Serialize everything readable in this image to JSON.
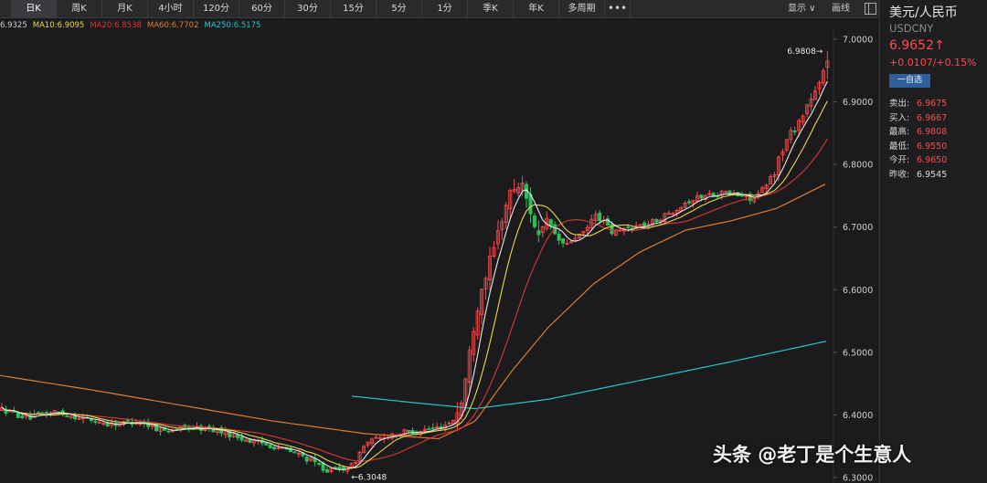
{
  "toolbar": {
    "timeframes": [
      {
        "label": "日K",
        "active": true
      },
      {
        "label": "周K",
        "active": false
      },
      {
        "label": "月K",
        "active": false
      },
      {
        "label": "4小时",
        "active": false
      },
      {
        "label": "120分",
        "active": false
      },
      {
        "label": "60分",
        "active": false
      },
      {
        "label": "30分",
        "active": false
      },
      {
        "label": "15分",
        "active": false
      },
      {
        "label": "5分",
        "active": false
      },
      {
        "label": "1分",
        "active": false
      },
      {
        "label": "季K",
        "active": false
      },
      {
        "label": "年K",
        "active": false
      },
      {
        "label": "多周期",
        "active": false
      }
    ],
    "more_label": "•••",
    "display_label": "显示 ∨",
    "draw_label": "画线"
  },
  "ma_bar": {
    "items": [
      {
        "label": "6.9325",
        "color": "#cfcfcf"
      },
      {
        "label": "MA10:6.9095",
        "color": "#e8d84a"
      },
      {
        "label": "MA20:6.8538",
        "color": "#d83838"
      },
      {
        "label": "MA60:6.7702",
        "color": "#e07a2a"
      },
      {
        "label": "MA250:6.5175",
        "color": "#26c6c6"
      }
    ]
  },
  "chart_data": {
    "type": "candlestick",
    "y_ticks": [
      "7.0000",
      "6.9000",
      "6.8000",
      "6.7000",
      "6.6000",
      "6.5000",
      "6.4000",
      "6.3000"
    ],
    "ylim": [
      6.3,
      7.0
    ],
    "high_marker": "6.9808",
    "low_marker": "6.3048",
    "up_color": "#ff4a4a",
    "down_color": "#2fbf5a",
    "ma_colors": {
      "ma5": "#e8e8e8",
      "ma10": "#e8d84a",
      "ma20": "#d83838",
      "ma60": "#e07a2a",
      "ma250": "#26c6c6"
    },
    "segments": [
      [
        0,
        6.41
      ],
      [
        30,
        6.395
      ],
      [
        60,
        6.405
      ],
      [
        90,
        6.395
      ],
      [
        120,
        6.385
      ],
      [
        150,
        6.39
      ],
      [
        180,
        6.375
      ],
      [
        210,
        6.38
      ],
      [
        240,
        6.375
      ],
      [
        270,
        6.36
      ],
      [
        300,
        6.35
      ],
      [
        330,
        6.335
      ],
      [
        360,
        6.31
      ],
      [
        385,
        6.318
      ],
      [
        400,
        6.355
      ],
      [
        430,
        6.37
      ],
      [
        460,
        6.375
      ],
      [
        480,
        6.38
      ],
      [
        495,
        6.39
      ],
      [
        505,
        6.42
      ],
      [
        512,
        6.48
      ],
      [
        520,
        6.56
      ],
      [
        530,
        6.62
      ],
      [
        540,
        6.66
      ],
      [
        550,
        6.72
      ],
      [
        560,
        6.76
      ],
      [
        570,
        6.77
      ],
      [
        580,
        6.73
      ],
      [
        590,
        6.68
      ],
      [
        600,
        6.71
      ],
      [
        610,
        6.68
      ],
      [
        620,
        6.67
      ],
      [
        630,
        6.685
      ],
      [
        640,
        6.69
      ],
      [
        650,
        6.72
      ],
      [
        660,
        6.71
      ],
      [
        670,
        6.69
      ],
      [
        690,
        6.7
      ],
      [
        710,
        6.705
      ],
      [
        730,
        6.72
      ],
      [
        750,
        6.74
      ],
      [
        770,
        6.75
      ],
      [
        790,
        6.755
      ],
      [
        810,
        6.75
      ],
      [
        825,
        6.745
      ],
      [
        835,
        6.76
      ],
      [
        845,
        6.78
      ],
      [
        855,
        6.82
      ],
      [
        865,
        6.85
      ],
      [
        875,
        6.87
      ],
      [
        885,
        6.9
      ],
      [
        895,
        6.92
      ],
      [
        905,
        6.965
      ]
    ],
    "ma250_start_x": 385,
    "ma250_points": [
      [
        385,
        6.43
      ],
      [
        450,
        6.42
      ],
      [
        520,
        6.41
      ],
      [
        600,
        6.425
      ],
      [
        700,
        6.455
      ],
      [
        800,
        6.485
      ],
      [
        905,
        6.518
      ]
    ],
    "ma60_points": [
      [
        0,
        6.463
      ],
      [
        100,
        6.44
      ],
      [
        200,
        6.415
      ],
      [
        300,
        6.39
      ],
      [
        400,
        6.37
      ],
      [
        480,
        6.362
      ],
      [
        520,
        6.39
      ],
      [
        560,
        6.47
      ],
      [
        600,
        6.54
      ],
      [
        650,
        6.61
      ],
      [
        700,
        6.66
      ],
      [
        750,
        6.695
      ],
      [
        800,
        6.71
      ],
      [
        850,
        6.73
      ],
      [
        905,
        6.77
      ]
    ]
  },
  "side": {
    "name": "美元/人民币",
    "code": "USDCNY",
    "price": "6.9652↑",
    "change": "+0.0107/+0.15%",
    "watch_label": "一自选",
    "quote_rows": [
      {
        "label": "卖出:",
        "value": "6.9675",
        "up": true
      },
      {
        "label": "买入:",
        "value": "6.9667",
        "up": true
      },
      {
        "label": "最高:",
        "value": "6.9808",
        "up": true
      },
      {
        "label": "最低:",
        "value": "6.9550",
        "up": true
      },
      {
        "label": "今开:",
        "value": "6.9650",
        "up": true
      },
      {
        "label": "昨收:",
        "value": "6.9545",
        "up": false
      }
    ]
  },
  "watermark": "头条 @老丁是个生意人"
}
